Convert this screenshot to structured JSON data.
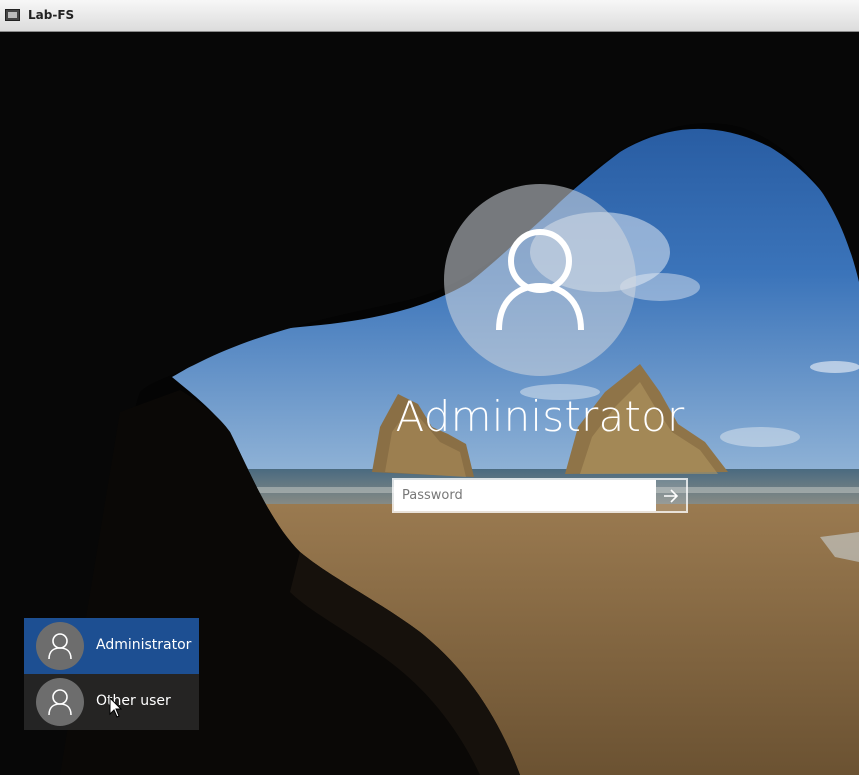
{
  "window": {
    "title": "Lab-FS",
    "icon": "console-window-icon"
  },
  "login": {
    "avatar_icon": "user-silhouette-icon",
    "username": "Administrator",
    "password_placeholder": "Password",
    "submit_icon": "arrow-right-icon"
  },
  "user_list": [
    {
      "label": "Administrator",
      "selected": true,
      "icon": "user-silhouette-icon"
    },
    {
      "label": "Other user",
      "selected": false,
      "icon": "user-silhouette-icon"
    }
  ],
  "colors": {
    "selected_tile": "#1d4f92",
    "text": "#ffffff"
  }
}
